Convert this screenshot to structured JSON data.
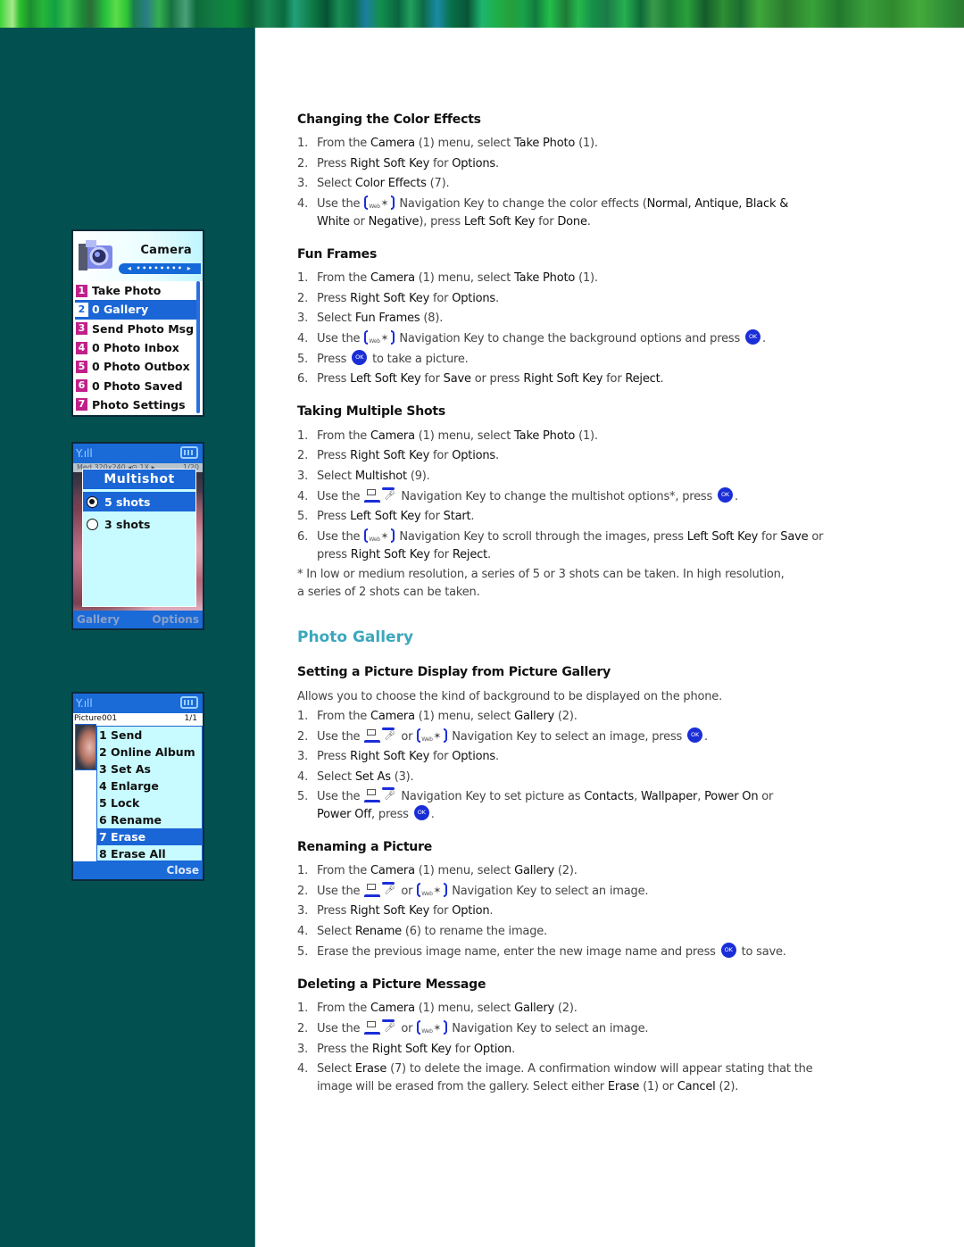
{
  "phones": {
    "camera_menu": {
      "title": "Camera",
      "pager": "◂ •••••••• ▸",
      "items": [
        {
          "num": "1",
          "label": "Take Photo",
          "selected": false
        },
        {
          "num": "2",
          "label": "0 Gallery",
          "selected": true
        },
        {
          "num": "3",
          "label": "Send Photo Msg",
          "selected": false
        },
        {
          "num": "4",
          "label": "0 Photo Inbox",
          "selected": false
        },
        {
          "num": "5",
          "label": "0 Photo Outbox",
          "selected": false
        },
        {
          "num": "6",
          "label": "0 Photo Saved",
          "selected": false
        },
        {
          "num": "7",
          "label": "Photo Settings",
          "selected": false
        }
      ]
    },
    "multishot": {
      "signal": "Y.ıll",
      "info_left": "Med 320x240  ◂⊙ 1X ▸",
      "info_right": "1/20",
      "title": "Multishot",
      "options": [
        {
          "label": "5 shots",
          "selected": true
        },
        {
          "label": "3 shots",
          "selected": false
        }
      ],
      "left_soft": "Gallery",
      "right_soft": "Options"
    },
    "gallery_options": {
      "signal": "Y.ıll",
      "filename": "Picture001",
      "count": "1/1",
      "items": [
        {
          "label": "1 Send",
          "selected": false
        },
        {
          "label": "2 Online Album",
          "selected": false
        },
        {
          "label": "3 Set As",
          "selected": false
        },
        {
          "label": "4 Enlarge",
          "selected": false
        },
        {
          "label": "5 Lock",
          "selected": false
        },
        {
          "label": "6 Rename",
          "selected": false
        },
        {
          "label": "7 Erase",
          "selected": true
        },
        {
          "label": "8 Erase All",
          "selected": false
        }
      ],
      "right_soft": "Close"
    }
  },
  "doc": {
    "color_effects": {
      "heading": "Changing the Color Effects",
      "s1": {
        "n": "1.",
        "a": "From the ",
        "b1": "Camera",
        "c": " (1) menu, select ",
        "b2": "Take Photo",
        "d": " (1)."
      },
      "s2": {
        "n": "2.",
        "a": "Press ",
        "b1": "Right Soft Key",
        "c": " for ",
        "b2": "Options",
        "d": "."
      },
      "s3": {
        "n": "3.",
        "a": "Select ",
        "b1": "Color Effects",
        "c": " (7)."
      },
      "s4": {
        "n": "4.",
        "a": "Use the",
        "c": "Navigation Key to change the color effects (",
        "b1": "Normal, Antique, Black & White",
        "d": " or ",
        "b2": "Negative",
        "e": "), press ",
        "b3": "Left Soft Key",
        "f": " for ",
        "b4": "Done",
        "g": "."
      }
    },
    "fun_frames": {
      "heading": "Fun Frames",
      "s1": {
        "n": "1.",
        "a": "From the ",
        "b1": "Camera",
        "c": " (1) menu, select ",
        "b2": "Take Photo",
        "d": " (1)."
      },
      "s2": {
        "n": "2.",
        "a": "Press ",
        "b1": "Right Soft Key",
        "c": " for ",
        "b2": "Options",
        "d": "."
      },
      "s3": {
        "n": "3.",
        "a": "Select ",
        "b1": "Fun Frames",
        "c": " (8)."
      },
      "s4": {
        "n": "4.",
        "a": "Use the",
        "c": "Navigation Key to change the background options and press",
        "d": "."
      },
      "s5": {
        "n": "5.",
        "a": "Press",
        "c": "to take a picture."
      },
      "s6": {
        "n": "6.",
        "a": "Press ",
        "b1": "Left Soft Key",
        "c": " for ",
        "b2": "Save",
        "d": " or press ",
        "b3": "Right Soft Key",
        "e": " for ",
        "b4": "Reject",
        "f": "."
      }
    },
    "multiple_shots": {
      "heading": "Taking Multiple Shots",
      "s1": {
        "n": "1.",
        "a": "From the ",
        "b1": "Camera",
        "c": " (1) menu, select ",
        "b2": "Take Photo",
        "d": " (1)."
      },
      "s2": {
        "n": "2.",
        "a": "Press ",
        "b1": "Right Soft Key",
        "c": " for ",
        "b2": "Options",
        "d": "."
      },
      "s3": {
        "n": "3.",
        "a": "Select ",
        "b1": "Multishot",
        "c": " (9)."
      },
      "s4": {
        "n": "4.",
        "a": "Use the",
        "c": "Navigation Key to change the multishot options*, press",
        "d": "."
      },
      "s5": {
        "n": "5.",
        "a": "Press ",
        "b1": "Left Soft Key",
        "c": " for ",
        "b2": "Start",
        "d": "."
      },
      "s6": {
        "n": "6.",
        "a": "Use the",
        "c": "Navigation Key to scroll through the images, press ",
        "b1": "Left Soft Key",
        "d": " for ",
        "b2": "Save",
        "e": " or press ",
        "b3": "Right Soft Key",
        "f": " for ",
        "b4": "Reject",
        "g": "."
      },
      "footnote_1": "* In low or medium resolution, a series of 5 or 3 shots can be taken. In high resolution,",
      "footnote_2": "a series of 2 shots can be taken."
    },
    "photo_gallery": {
      "title": "Photo Gallery",
      "set_display": {
        "heading": "Setting a Picture Display from Picture Gallery",
        "intro": "Allows you to choose the kind of background to be displayed on the phone.",
        "s1": {
          "n": "1.",
          "a": "From the ",
          "b1": "Camera",
          "c": " (1) menu, select ",
          "b2": "Gallery",
          "d": " (2)."
        },
        "s2": {
          "n": "2.",
          "a": "Use the",
          "or": "or",
          "c": "Navigation Key to select an image, press",
          "d": "."
        },
        "s3": {
          "n": "3.",
          "a": "Press ",
          "b1": "Right Soft Key",
          "c": " for ",
          "b2": "Options",
          "d": "."
        },
        "s4": {
          "n": "4.",
          "a": "Select ",
          "b1": "Set As",
          "c": " (3)."
        },
        "s5": {
          "n": "5.",
          "a": "Use the",
          "c": "Navigation Key to set picture as ",
          "b1": "Contacts",
          "d": ", ",
          "b2": "Wallpaper",
          "e": ", ",
          "b3": "Power On",
          "f": " or ",
          "b4": "Power Off",
          "g": ", press",
          "h": "."
        }
      },
      "rename": {
        "heading": "Renaming a Picture",
        "s1": {
          "n": "1.",
          "a": "From the ",
          "b1": "Camera",
          "c": " (1) menu, select ",
          "b2": "Gallery",
          "d": " (2)."
        },
        "s2": {
          "n": "2.",
          "a": "Use the",
          "or": "or",
          "c": "Navigation Key to select an image."
        },
        "s3": {
          "n": "3.",
          "a": "Press ",
          "b1": "Right Soft Key",
          "c": " for ",
          "b2": "Option",
          "d": "."
        },
        "s4": {
          "n": "4.",
          "a": "Select ",
          "b1": "Rename",
          "c": " (6) to rename the image."
        },
        "s5": {
          "n": "5.",
          "a": "Erase the previous image name, enter the new image name and press",
          "c": "to save."
        }
      },
      "delete": {
        "heading": "Deleting a Picture Message",
        "s1": {
          "n": "1.",
          "a": "From the ",
          "b1": "Camera",
          "c": " (1) menu, select ",
          "b2": "Gallery",
          "d": " (2)."
        },
        "s2": {
          "n": "2.",
          "a": "Use the",
          "or": "or",
          "c": "Navigation Key to select an image."
        },
        "s3": {
          "n": "3.",
          "a": "Press the ",
          "b1": "Right Soft Key",
          "c": " for ",
          "b2": "Option",
          "d": "."
        },
        "s4": {
          "n": "4.",
          "a": "Select ",
          "b1": "Erase",
          "c": " (7) to delete the image.  A confirmation window will appear stating that the image will be erased from the gallery. Select either ",
          "b2": "Erase",
          "d": " (1) or ",
          "b3": "Cancel",
          "e": " (2)."
        }
      }
    },
    "icons": {
      "ok_label": "OK",
      "web_label": "Web",
      "star": "✶",
      "mic": "ᵟ"
    }
  },
  "colors": {
    "sidebar": "#035050",
    "heading_accent": "#3ba7bd",
    "phone_blue": "#1a66d6",
    "menu_number": "#c0208a",
    "popup_bg": "#c8fbff",
    "nav_key_blue": "#1a2ed8"
  }
}
